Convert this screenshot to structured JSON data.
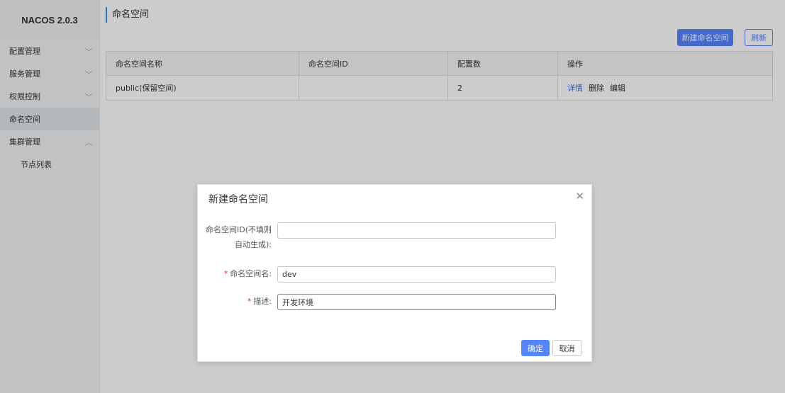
{
  "sidebar": {
    "brand": "NACOS 2.0.3",
    "items": [
      {
        "label": "配置管理",
        "chevron": "﹀"
      },
      {
        "label": "服务管理",
        "chevron": "﹀"
      },
      {
        "label": "权限控制",
        "chevron": "﹀"
      },
      {
        "label": "命名空间",
        "chevron": ""
      },
      {
        "label": "集群管理",
        "chevron": "︿"
      }
    ],
    "sub_items": [
      {
        "label": "节点列表"
      }
    ]
  },
  "main": {
    "title": "命名空间",
    "new_button": "新建命名空间",
    "refresh_button": "刷新",
    "table": {
      "headers": [
        "命名空间名称",
        "命名空间ID",
        "配置数",
        "操作"
      ],
      "rows": [
        {
          "name": "public(保留空间)",
          "id": "",
          "count": "2",
          "actions": [
            "详情",
            "删除",
            "编辑"
          ]
        }
      ]
    }
  },
  "dialog": {
    "title": "新建命名空间",
    "fields": {
      "id_label_line1": "命名空间ID(不填则",
      "id_label_line2": "自动生成):",
      "id_value": "",
      "name_label": "命名空间名:",
      "name_value": "dev",
      "desc_label": "描述:",
      "desc_value": "开发环境"
    },
    "required_mark": "*",
    "ok_button": "确定",
    "cancel_button": "取消",
    "close_icon": "close-icon"
  },
  "colors": {
    "primary": "#5584ff",
    "required": "#e52e2e",
    "link": "#2d6cf0"
  }
}
